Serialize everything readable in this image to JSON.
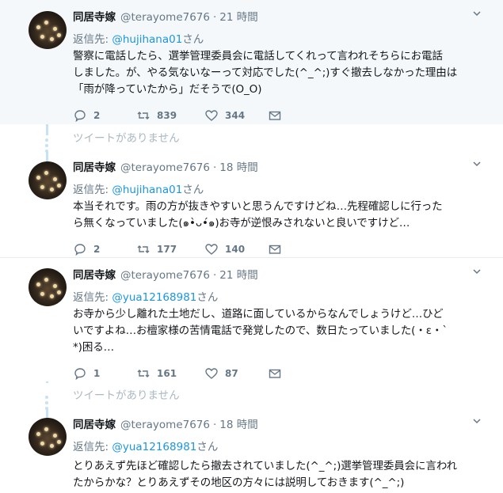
{
  "tweets": [
    {
      "name": "同居寺嫁",
      "handle": "@terayome7676",
      "time": "21 時間",
      "reply_prefix": "返信先: ",
      "reply_handle": "@hujihana01",
      "reply_suffix": "さん",
      "lines": [
        "警察に電話したら、選挙管理委員会に電話してくれって言われそちらにお電話",
        "しました。が、やる気ないなーって対応でした(^_^;)すぐ撤去しなかった理由は",
        "「雨が降っていたから」だそうで(O_O)"
      ],
      "replies": "2",
      "retweets": "839",
      "likes": "344"
    },
    {
      "name": "同居寺嫁",
      "handle": "@terayome7676",
      "time": "18 時間",
      "reply_prefix": "返信先: ",
      "reply_handle": "@hujihana01",
      "reply_suffix": "さん",
      "lines": [
        "本当それです。雨の方が抜きやすいと思うんですけどね…先程確認しに行った",
        "ら無くなっていました(๑•̀ᴗ•́๑)お寺が逆恨みされないと良いですけど…"
      ],
      "replies": "2",
      "retweets": "177",
      "likes": "140"
    },
    {
      "name": "同居寺嫁",
      "handle": "@terayome7676",
      "time": "21 時間",
      "reply_prefix": "返信先: ",
      "reply_handle": "@yua12168981",
      "reply_suffix": "さん",
      "lines": [
        "お寺から少し離れた土地だし、道路に面しているからなんでしょうけど…ひど",
        "いですよね…お檀家様の苦情電話で発覚したので、数日たっていました(・ε・`",
        "*)困る…"
      ],
      "replies": "1",
      "retweets": "161",
      "likes": "87"
    },
    {
      "name": "同居寺嫁",
      "handle": "@terayome7676",
      "time": "18 時間",
      "reply_prefix": "返信先: ",
      "reply_handle": "@yua12168981",
      "reply_suffix": "さん",
      "lines": [
        "とりあえず先ほど確認したら撤去されていました(^_^;)選挙管理委員会に言われ",
        "たからかな？とりあえずその地区の方々には説明しておきます(^_^;)"
      ]
    }
  ],
  "unavailable_text": "ツイートがありません",
  "icons": {
    "reply": "speech-bubble-icon",
    "retweet": "retweet-arrows-icon",
    "like": "heart-icon",
    "dm": "envelope-icon",
    "more": "chevron-down-icon"
  },
  "colors": {
    "link": "#1b95e0",
    "muted": "#657786",
    "thread": "#c6e2f5",
    "highlight_bg": "#f5f8fa"
  }
}
